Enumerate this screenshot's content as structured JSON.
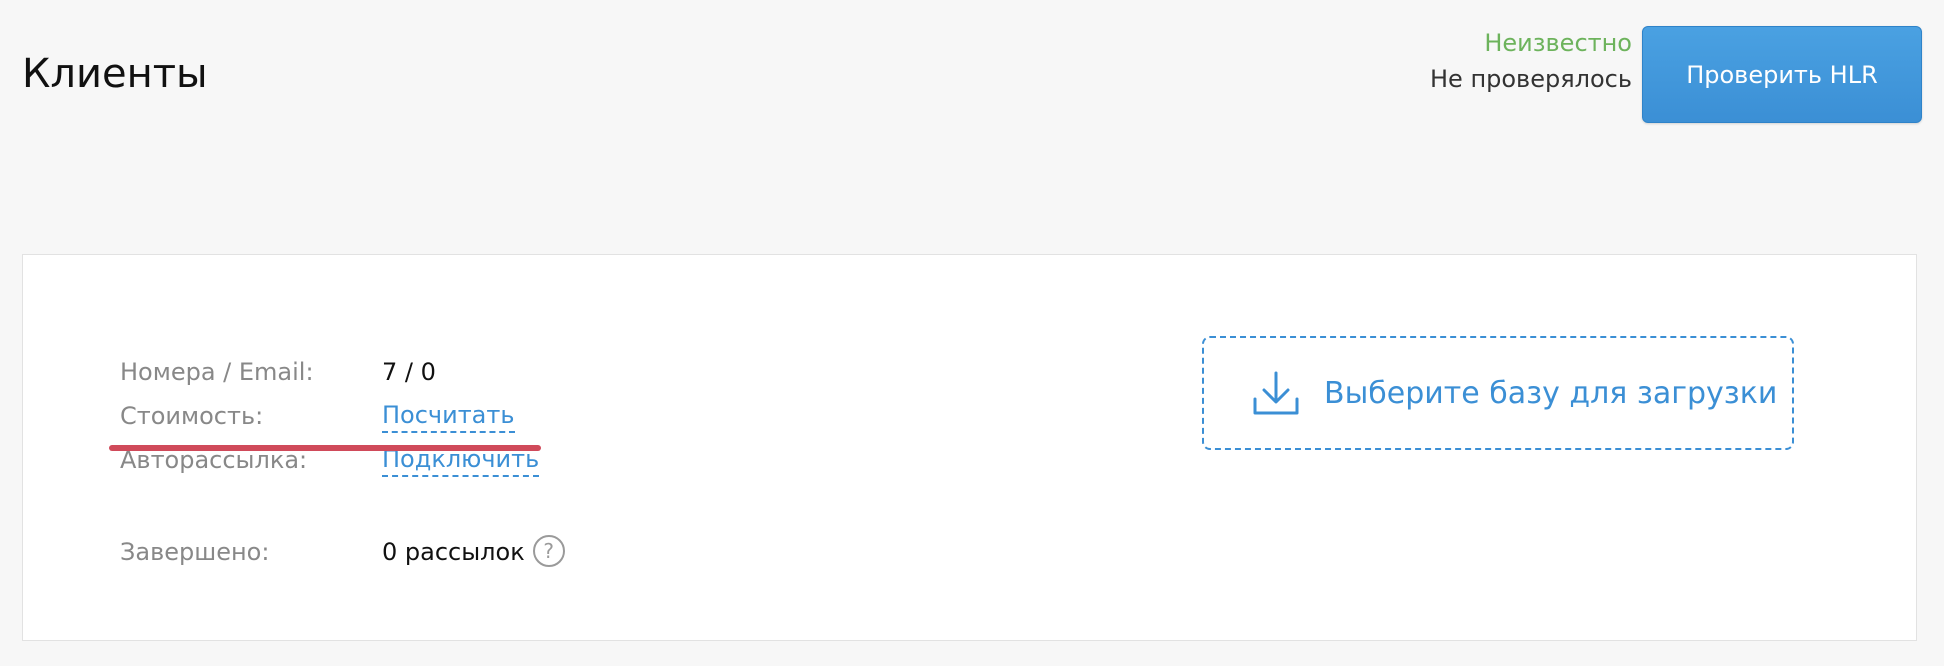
{
  "header": {
    "title": "Клиенты",
    "hlr_status_label": "Неизвестно",
    "hlr_status_value": "Не проверялось",
    "hlr_button_label": "Проверить HLR"
  },
  "stats": {
    "numbers_label": "Номера / Email:",
    "numbers_value": "7 / 0",
    "cost_label": "Стоимость:",
    "cost_link": "Посчитать",
    "autosend_label": "Авторассылка:",
    "autosend_link": "Подключить",
    "completed_label": "Завершено:",
    "completed_value": "0 рассылок",
    "help_glyph": "?"
  },
  "upload": {
    "label": "Выберите базу для загрузки",
    "icon": "download-icon"
  },
  "colors": {
    "accent_blue": "#3b8fd5",
    "status_green": "#6db35c",
    "highlight_red": "#d04a5a"
  }
}
